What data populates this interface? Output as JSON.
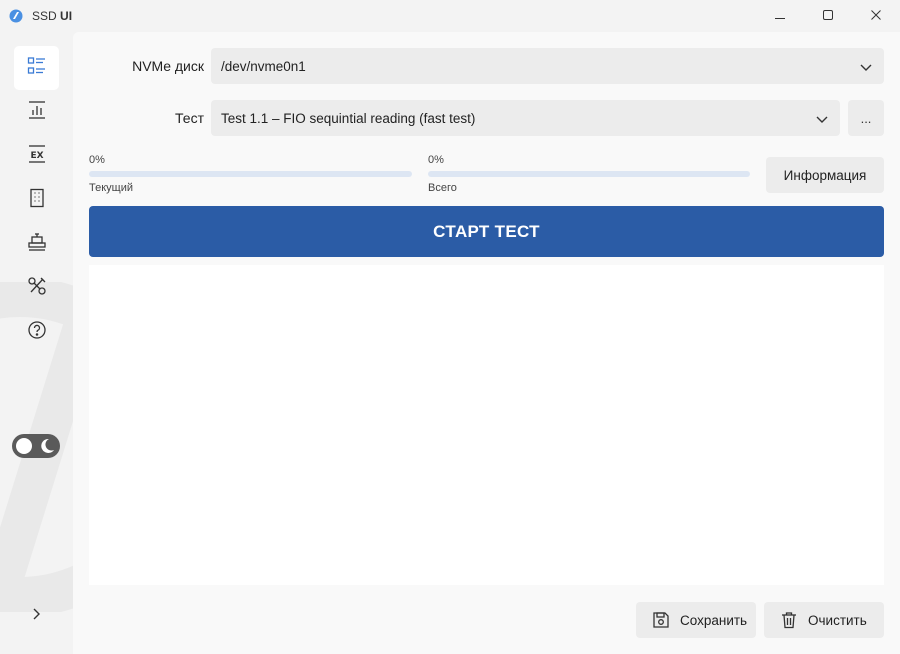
{
  "titlebar": {
    "app_name": "SSD",
    "app_name_suffix": "UI",
    "icons": {
      "app": "app-logo-icon",
      "minimize": "minimize-icon",
      "maximize": "maximize-icon",
      "close": "close-icon"
    }
  },
  "sidebar": {
    "items": [
      {
        "id": "overview",
        "icon": "list-icon",
        "active": true
      },
      {
        "id": "charts",
        "icon": "bar-chart-icon",
        "active": false
      },
      {
        "id": "ex",
        "icon": "ex-icon",
        "active": false
      },
      {
        "id": "building",
        "icon": "building-icon",
        "active": false
      },
      {
        "id": "machine",
        "icon": "machine-icon",
        "active": false
      },
      {
        "id": "tools",
        "icon": "tools-icon",
        "active": false
      },
      {
        "id": "help",
        "icon": "help-icon",
        "active": false
      }
    ],
    "theme_toggle": "theme-toggle",
    "expand_icon": "chevron-right-icon"
  },
  "form": {
    "disk_label": "NVMe диск",
    "disk_value": "/dev/nvme0n1",
    "test_label": "Тест",
    "test_value": "Test 1.1 – FIO sequintial reading (fast test)",
    "more_label": "..."
  },
  "progress": {
    "current": {
      "percent_text": "0%",
      "label": "Текущий",
      "value": 0
    },
    "total": {
      "percent_text": "0%",
      "label": "Всего",
      "value": 0
    }
  },
  "buttons": {
    "info": "Информация",
    "start": "СТАРТ ТЕСТ",
    "save": "Сохранить",
    "clear": "Очистить"
  },
  "colors": {
    "accent": "#2b5ca6",
    "progress_track": "#dde6f3",
    "button_bg": "#ececec"
  }
}
